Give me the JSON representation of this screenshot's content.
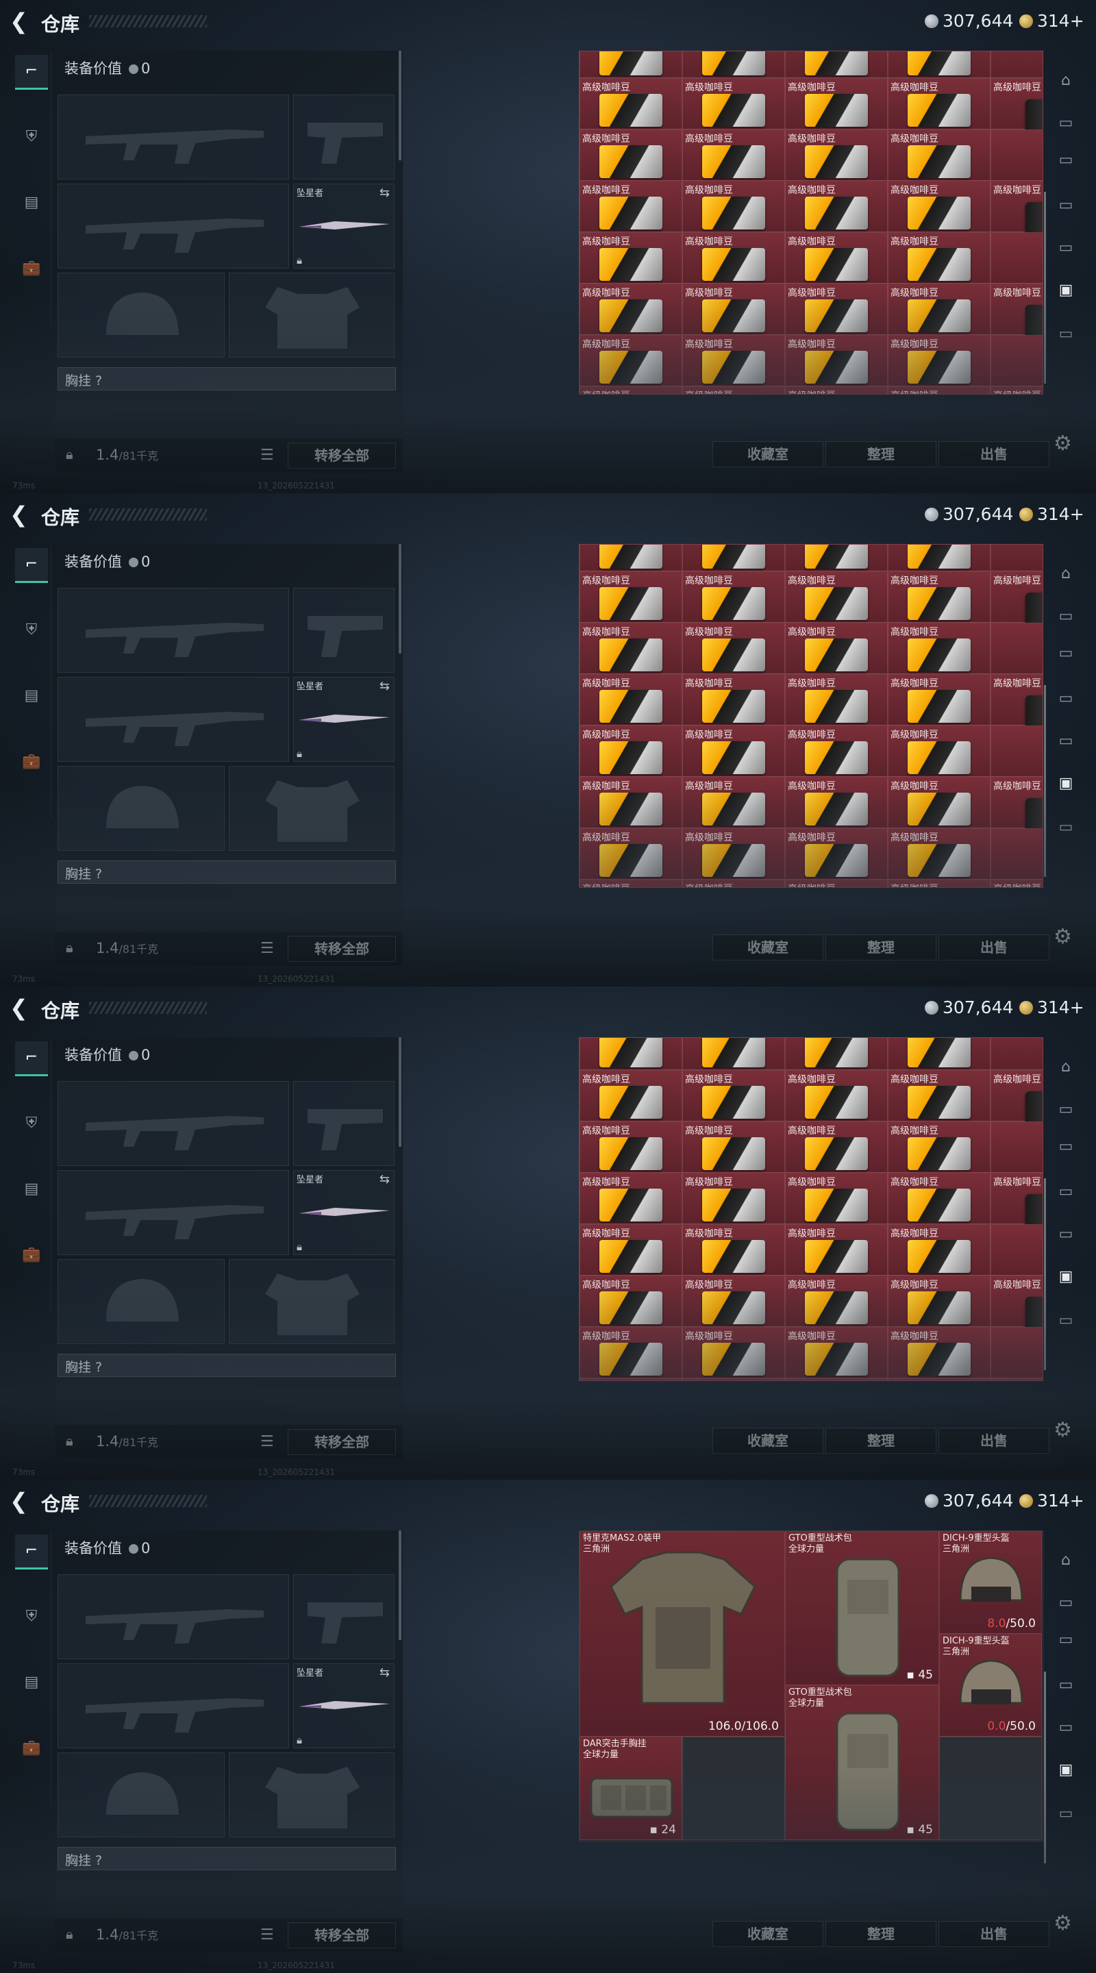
{
  "header": {
    "title": "仓库",
    "back_icon": "chevron-left-icon"
  },
  "currency": {
    "silver": "307,644",
    "gold": "314+"
  },
  "equip": {
    "value_label": "装备价值",
    "value": "0",
    "melee_name": "坠星者",
    "chest_label": "胸挂 ?",
    "weight": "1.4",
    "weight_max": "/81千克",
    "transfer_label": "转移全部"
  },
  "actions": {
    "collection": "收藏室",
    "sort": "整理",
    "sell": "出售"
  },
  "status": {
    "ping": "73ms",
    "build": "13_2026052214​31"
  },
  "item_name": "高级咖啡豆",
  "gear_items": {
    "armor": {
      "name1": "特里克MAS2.0装甲",
      "name2": "三角洲",
      "durability": "106.0/106.0"
    },
    "backpack1": {
      "name1": "GTO重型战术包",
      "name2": "全球力量",
      "capacity": "45"
    },
    "helmet1": {
      "name1": "DICH-9重型头盔",
      "name2": "三角洲",
      "cur": "8.0",
      "max": "/50.0"
    },
    "helmet2": {
      "name1": "DICH-9重型头盔",
      "name2": "三角洲",
      "cur": "0.0",
      "max": "/50.0"
    },
    "backpack2": {
      "name1": "GTO重型战术包",
      "name2": "全球力量",
      "capacity": "45"
    },
    "rig": {
      "name1": "DAR突击手胸挂",
      "name2": "全球力量",
      "capacity": "24"
    }
  }
}
